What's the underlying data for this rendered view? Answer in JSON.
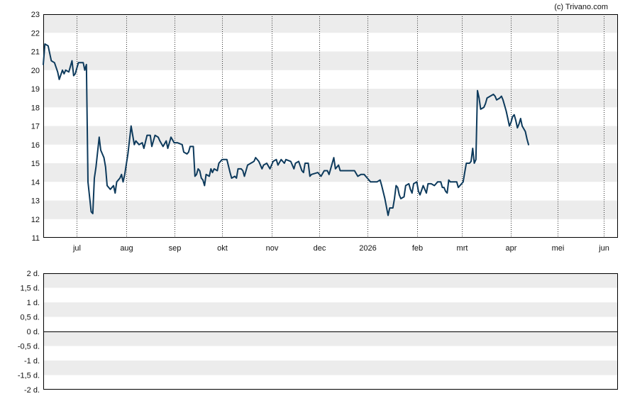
{
  "credit": "(c) Trivano.com",
  "colors": {
    "line": "#0d3a5c",
    "band": "#ececec",
    "axis": "#000000",
    "grid": "#333333"
  },
  "chart_data": [
    {
      "type": "line",
      "title": "",
      "ylim": [
        11,
        23
      ],
      "yticks": [
        "11",
        "12",
        "13",
        "14",
        "15",
        "16",
        "17",
        "18",
        "19",
        "20",
        "21",
        "22",
        "23"
      ],
      "x_month_labels": [
        "jul",
        "aug",
        "sep",
        "okt",
        "nov",
        "dec",
        "2026",
        "feb",
        "mrt",
        "apr",
        "mei",
        "jun"
      ],
      "x_month_positions_days": [
        21,
        52,
        82,
        112,
        143,
        173,
        203,
        234,
        262,
        293,
        322,
        351
      ],
      "x_range_days": [
        0,
        360
      ],
      "grid": true,
      "series": [
        {
          "values": [
            [
              0,
              20.3
            ],
            [
              1,
              21.4
            ],
            [
              3,
              21.3
            ],
            [
              5,
              20.5
            ],
            [
              7,
              20.4
            ],
            [
              9,
              19.9
            ],
            [
              10,
              19.5
            ],
            [
              12,
              20.0
            ],
            [
              13,
              19.8
            ],
            [
              14,
              20.0
            ],
            [
              16,
              19.9
            ],
            [
              18,
              20.5
            ],
            [
              19,
              19.7
            ],
            [
              20,
              19.8
            ],
            [
              22,
              20.4
            ],
            [
              25,
              20.4
            ],
            [
              26,
              20.0
            ],
            [
              27,
              20.3
            ],
            [
              28,
              14.0
            ],
            [
              30,
              12.4
            ],
            [
              31,
              12.3
            ],
            [
              32,
              14.2
            ],
            [
              33,
              14.8
            ],
            [
              35,
              16.4
            ],
            [
              36,
              15.7
            ],
            [
              38,
              15.3
            ],
            [
              39,
              14.8
            ],
            [
              40,
              13.8
            ],
            [
              42,
              13.6
            ],
            [
              44,
              13.8
            ],
            [
              45,
              13.4
            ],
            [
              46,
              14.0
            ],
            [
              48,
              14.2
            ],
            [
              49,
              14.4
            ],
            [
              50,
              14.0
            ],
            [
              51,
              14.4
            ],
            [
              53,
              15.5
            ],
            [
              55,
              17.0
            ],
            [
              57,
              16.0
            ],
            [
              58,
              16.2
            ],
            [
              60,
              16.0
            ],
            [
              62,
              16.1
            ],
            [
              63,
              15.8
            ],
            [
              65,
              16.5
            ],
            [
              67,
              16.5
            ],
            [
              68,
              15.9
            ],
            [
              70,
              16.5
            ],
            [
              72,
              16.4
            ],
            [
              73,
              16.2
            ],
            [
              75,
              15.9
            ],
            [
              77,
              16.2
            ],
            [
              78,
              15.8
            ],
            [
              80,
              16.4
            ],
            [
              82,
              16.1
            ],
            [
              84,
              16.1
            ],
            [
              87,
              16.0
            ],
            [
              88,
              15.6
            ],
            [
              90,
              15.5
            ],
            [
              91,
              15.6
            ],
            [
              92,
              15.9
            ],
            [
              94,
              15.9
            ],
            [
              95,
              14.3
            ],
            [
              96,
              14.4
            ],
            [
              97,
              14.7
            ],
            [
              98,
              14.6
            ],
            [
              99,
              14.2
            ],
            [
              100,
              14.1
            ],
            [
              101,
              13.8
            ],
            [
              102,
              14.4
            ],
            [
              104,
              14.3
            ],
            [
              105,
              14.7
            ],
            [
              106,
              14.5
            ],
            [
              107,
              14.7
            ],
            [
              109,
              14.6
            ],
            [
              110,
              15.0
            ],
            [
              112,
              15.2
            ],
            [
              113,
              15.2
            ],
            [
              115,
              15.2
            ],
            [
              117,
              14.5
            ],
            [
              118,
              14.2
            ],
            [
              120,
              14.3
            ],
            [
              121,
              14.2
            ],
            [
              122,
              14.7
            ],
            [
              124,
              14.7
            ],
            [
              125,
              14.6
            ],
            [
              126,
              14.3
            ],
            [
              128,
              14.9
            ],
            [
              130,
              15.0
            ],
            [
              132,
              15.1
            ],
            [
              133,
              15.3
            ],
            [
              135,
              15.1
            ],
            [
              137,
              14.7
            ],
            [
              138,
              14.9
            ],
            [
              140,
              15.0
            ],
            [
              142,
              14.7
            ],
            [
              144,
              15.1
            ],
            [
              146,
              15.2
            ],
            [
              147,
              14.9
            ],
            [
              149,
              15.2
            ],
            [
              151,
              15.0
            ],
            [
              152,
              15.2
            ],
            [
              155,
              15.1
            ],
            [
              157,
              14.7
            ],
            [
              158,
              15.0
            ],
            [
              160,
              15.1
            ],
            [
              162,
              14.6
            ],
            [
              163,
              14.5
            ],
            [
              164,
              15.0
            ],
            [
              166,
              15.0
            ],
            [
              167,
              14.3
            ],
            [
              168,
              14.4
            ],
            [
              172,
              14.5
            ],
            [
              174,
              14.3
            ],
            [
              176,
              14.6
            ],
            [
              178,
              14.6
            ],
            [
              179,
              14.4
            ],
            [
              181,
              15.0
            ],
            [
              182,
              15.3
            ],
            [
              183,
              14.7
            ],
            [
              185,
              14.9
            ],
            [
              186,
              14.6
            ],
            [
              188,
              14.6
            ],
            [
              195,
              14.6
            ],
            [
              197,
              14.3
            ],
            [
              199,
              14.4
            ],
            [
              201,
              14.4
            ],
            [
              203,
              14.2
            ],
            [
              205,
              14.0
            ],
            [
              209,
              14.0
            ],
            [
              211,
              14.1
            ],
            [
              212,
              13.8
            ],
            [
              214,
              13.1
            ],
            [
              216,
              12.2
            ],
            [
              217,
              12.6
            ],
            [
              219,
              12.6
            ],
            [
              220,
              13.1
            ],
            [
              221,
              13.8
            ],
            [
              222,
              13.7
            ],
            [
              223,
              13.3
            ],
            [
              224,
              13.1
            ],
            [
              226,
              13.2
            ],
            [
              227,
              13.8
            ],
            [
              229,
              13.9
            ],
            [
              230,
              13.6
            ],
            [
              231,
              13.4
            ],
            [
              232,
              13.9
            ],
            [
              234,
              14.0
            ],
            [
              235,
              13.5
            ],
            [
              236,
              13.3
            ],
            [
              238,
              13.8
            ],
            [
              240,
              13.4
            ],
            [
              241,
              13.9
            ],
            [
              243,
              13.9
            ],
            [
              245,
              13.8
            ],
            [
              247,
              14.0
            ],
            [
              249,
              14.0
            ],
            [
              250,
              13.7
            ],
            [
              251,
              13.7
            ],
            [
              252,
              13.5
            ],
            [
              253,
              13.4
            ],
            [
              254,
              14.1
            ],
            [
              255,
              14.0
            ],
            [
              257,
              14.0
            ],
            [
              259,
              14.0
            ],
            [
              260,
              13.7
            ],
            [
              261,
              13.8
            ],
            [
              263,
              14.0
            ],
            [
              264,
              14.5
            ],
            [
              265,
              15.0
            ],
            [
              267,
              15.0
            ],
            [
              268,
              15.1
            ],
            [
              269,
              15.8
            ],
            [
              270,
              15.0
            ],
            [
              271,
              15.2
            ],
            [
              272,
              18.9
            ],
            [
              273,
              18.5
            ],
            [
              274,
              17.9
            ],
            [
              276,
              18.0
            ],
            [
              277,
              18.2
            ],
            [
              278,
              18.5
            ],
            [
              280,
              18.6
            ],
            [
              282,
              18.7
            ],
            [
              283,
              18.6
            ],
            [
              284,
              18.4
            ],
            [
              286,
              18.5
            ],
            [
              287,
              18.6
            ],
            [
              288,
              18.4
            ],
            [
              290,
              17.8
            ],
            [
              291,
              17.4
            ],
            [
              292,
              17.0
            ],
            [
              293,
              17.2
            ],
            [
              294,
              17.5
            ],
            [
              295,
              17.6
            ],
            [
              296,
              17.3
            ],
            [
              297,
              16.9
            ],
            [
              298,
              17.1
            ],
            [
              299,
              17.4
            ],
            [
              300,
              17.0
            ],
            [
              302,
              16.7
            ],
            [
              303,
              16.3
            ],
            [
              304,
              16.0
            ]
          ]
        }
      ]
    },
    {
      "type": "line",
      "title": "",
      "ylim": [
        -2,
        2
      ],
      "yticks": [
        "-2 d.",
        "-1,5 d.",
        "-1 d.",
        "-0,5 d.",
        "0 d.",
        "0,5 d.",
        "1 d.",
        "1,5 d.",
        "2 d."
      ],
      "grid": true,
      "series": []
    }
  ]
}
